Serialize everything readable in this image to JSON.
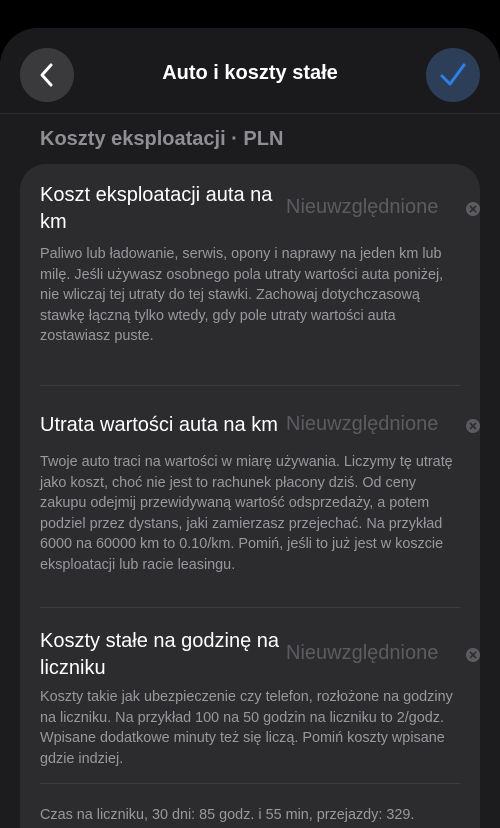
{
  "header": {
    "title": "Auto i koszty stałe",
    "back_icon": "chevron-left-icon",
    "confirm_icon": "checkmark-icon",
    "accent_color": "#2f7fe8"
  },
  "section": {
    "title": "Koszty eksploatacji · PLN"
  },
  "rows": [
    {
      "label": "Koszt eksploatacji auta na km",
      "value_placeholder": "Nieuwzględnione",
      "description": "Paliwo lub ładowanie, serwis, opony i naprawy na jeden km lub milę. Jeśli używasz osobnego pola utraty wartości auta poniżej, nie wliczaj tej utraty do tej stawki. Zachowaj dotychczasową stawkę łączną tylko wtedy, gdy pole utraty wartości auta zostawiasz puste."
    },
    {
      "label": "Utrata wartości auta na km",
      "value_placeholder": "Nieuwzględnione",
      "description": "Twoje auto traci na wartości w miarę używania. Liczymy tę utratę jako koszt, choć nie jest to rachunek płacony dziś. Od ceny zakupu odejmij przewidywaną wartość odsprzedaży, a potem podziel przez dystans, jaki zamierzasz przejechać. Na przykład 6000 na 60000 km to 0.10/km. Pomiń, jeśli to już jest w koszcie eksploatacji lub racie leasingu."
    },
    {
      "label": "Koszty stałe na godzinę na liczniku",
      "value_placeholder": "Nieuwzględnione",
      "description": "Koszty takie jak ubezpieczenie czy telefon, rozłożone na godziny na liczniku. Na przykład 100 na 50 godzin na liczniku to 2/godz. Wpisane dodatkowe minuty też się liczą. Pomiń koszty wpisane gdzie indziej."
    }
  ],
  "footer": {
    "summary": "Czas na liczniku, 30 dni: 85 godz. i 55 min, przejazdy: 329."
  }
}
